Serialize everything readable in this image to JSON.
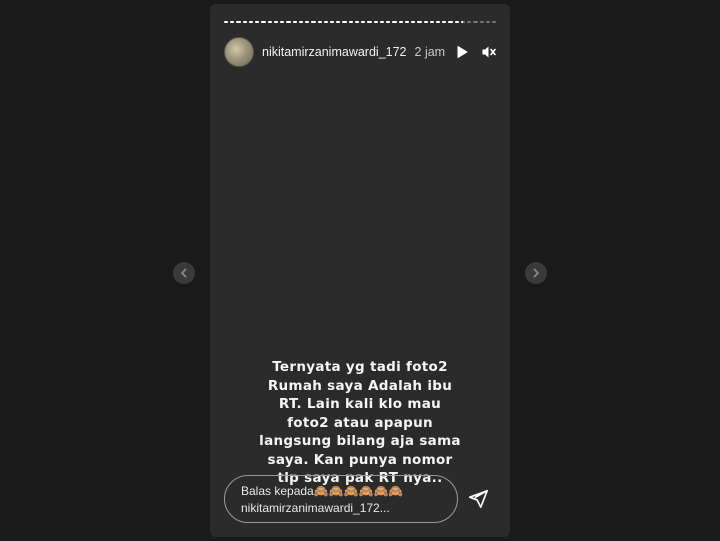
{
  "story": {
    "segments": [
      {
        "progress": 1
      },
      {
        "progress": 1
      },
      {
        "progress": 1
      },
      {
        "progress": 1
      },
      {
        "progress": 1
      },
      {
        "progress": 1
      },
      {
        "progress": 1
      },
      {
        "progress": 1
      },
      {
        "progress": 1
      },
      {
        "progress": 1
      },
      {
        "progress": 1
      },
      {
        "progress": 1
      },
      {
        "progress": 1
      },
      {
        "progress": 1
      },
      {
        "progress": 1
      },
      {
        "progress": 1
      },
      {
        "progress": 1
      },
      {
        "progress": 1
      },
      {
        "progress": 1
      },
      {
        "progress": 1
      },
      {
        "progress": 1
      },
      {
        "progress": 1
      },
      {
        "progress": 1
      },
      {
        "progress": 1
      },
      {
        "progress": 1
      },
      {
        "progress": 1
      },
      {
        "progress": 1
      },
      {
        "progress": 1
      },
      {
        "progress": 1
      },
      {
        "progress": 1
      },
      {
        "progress": 1
      },
      {
        "progress": 1
      },
      {
        "progress": 1
      },
      {
        "progress": 1
      },
      {
        "progress": 1
      },
      {
        "progress": 1
      },
      {
        "progress": 1
      },
      {
        "progress": 1
      },
      {
        "progress": 0.4
      },
      {
        "progress": 0
      },
      {
        "progress": 0
      },
      {
        "progress": 0
      },
      {
        "progress": 0
      },
      {
        "progress": 0
      }
    ],
    "header": {
      "username": "nikitamirzanimawardi_172",
      "time": "2 jam",
      "play_icon": "play-icon",
      "mute_icon": "mute-icon",
      "more_icon": "more-icon"
    },
    "caption_lines": [
      "Ternyata yg tadi foto2",
      "Rumah saya Adalah ibu",
      "RT. Lain kali klo mau",
      "foto2 atau apapun",
      "langsung bilang aja sama",
      "saya. Kan punya nomor",
      "tlp saya pak RT nya.."
    ],
    "reply": {
      "placeholder_line1": "Balas kepada🙈🙈🙈🙈🙈🙈",
      "placeholder_line2": "nikitamirzanimawardi_172..."
    }
  },
  "nav": {
    "prev_icon": "chevron-left-icon",
    "next_icon": "chevron-right-icon"
  },
  "colors": {
    "background": "#1a1a1a",
    "story_bg": "#2b2b2b",
    "text": "#f5f5f5"
  }
}
